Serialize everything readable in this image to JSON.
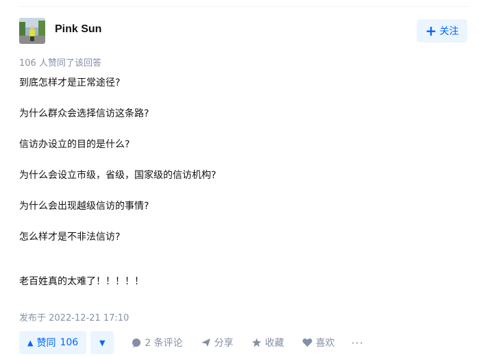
{
  "author": {
    "name": "Pink Sun"
  },
  "follow_button": {
    "icon": "plus-icon",
    "label": "关注"
  },
  "upvote_summary": "106 人赞同了该回答",
  "content": {
    "lines": [
      "到底怎样才是正常途径?",
      "为什么群众会选择信访这条路?",
      "信访办设立的目的是什么?",
      "为什么会设立市级，省级，国家级的信访机构?",
      "为什么会出现越级信访的事情?",
      "怎么样才是不非法信访?",
      "老百姓真的太难了！！！！！"
    ]
  },
  "publish_time": "发布于 2022-12-21 17:10",
  "actions": {
    "vote_up_label": "赞同",
    "vote_up_count": "106",
    "comments_label": "2 条评论",
    "share_label": "分享",
    "collect_label": "收藏",
    "like_label": "喜欢",
    "more_label": "···"
  },
  "colors": {
    "accent": "#0066ff",
    "accent_bg": "#ebf5ff",
    "muted": "#8590a6"
  }
}
